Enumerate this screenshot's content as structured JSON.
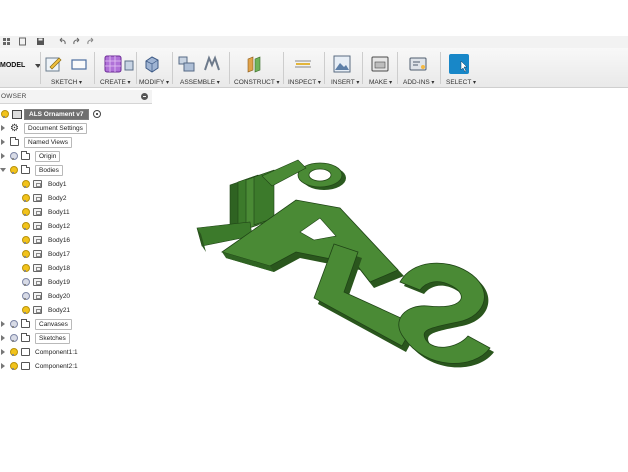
{
  "workspace": {
    "label": "MODEL"
  },
  "toolbar": {
    "groups": [
      {
        "label": "SKETCH"
      },
      {
        "label": "CREATE"
      },
      {
        "label": "MODIFY"
      },
      {
        "label": "ASSEMBLE"
      },
      {
        "label": "CONSTRUCT"
      },
      {
        "label": "INSPECT"
      },
      {
        "label": "INSERT"
      },
      {
        "label": "MAKE"
      },
      {
        "label": "ADD-INS"
      },
      {
        "label": "SELECT"
      }
    ]
  },
  "browser": {
    "title": "OWSER",
    "root": "ALS Ornament v7",
    "items": [
      {
        "label": "Document Settings"
      },
      {
        "label": "Named Views"
      },
      {
        "label": "Origin"
      },
      {
        "label": "Bodies"
      },
      {
        "label": "Canvases"
      },
      {
        "label": "Sketches"
      },
      {
        "label": "Component1:1"
      },
      {
        "label": "Component2:1"
      }
    ],
    "bodies": [
      "Body1",
      "Body2",
      "Body11",
      "Body12",
      "Body16",
      "Body17",
      "Body18",
      "Body19",
      "Body20",
      "Body21"
    ]
  },
  "model": {
    "letters": [
      "A",
      "L",
      "S"
    ],
    "color": "#3f7a2c",
    "shade": "#2a5a1e"
  }
}
